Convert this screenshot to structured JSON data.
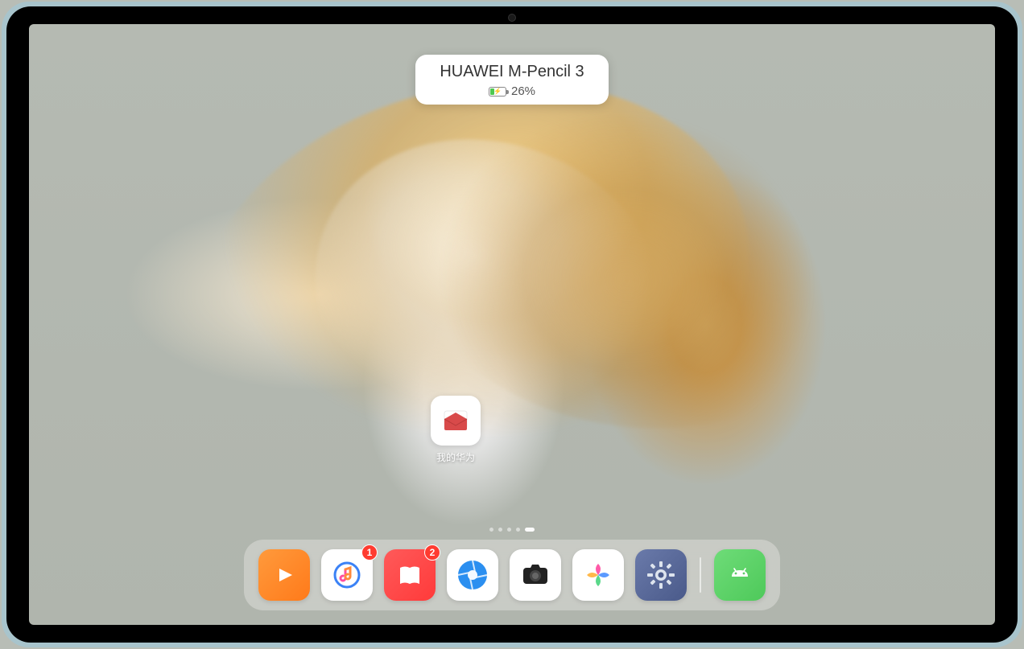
{
  "notification": {
    "title": "HUAWEI M-Pencil 3",
    "battery_pct": "26%"
  },
  "home_app": {
    "label": "我的华为"
  },
  "page_indicator": {
    "count": 5,
    "active_index": 4
  },
  "dock": {
    "items": [
      {
        "name": "video",
        "badge": ""
      },
      {
        "name": "music",
        "badge": "1"
      },
      {
        "name": "books",
        "badge": "2"
      },
      {
        "name": "browser",
        "badge": ""
      },
      {
        "name": "camera",
        "badge": ""
      },
      {
        "name": "gallery",
        "badge": ""
      },
      {
        "name": "settings",
        "badge": ""
      }
    ],
    "recent": [
      {
        "name": "android",
        "badge": ""
      }
    ]
  }
}
